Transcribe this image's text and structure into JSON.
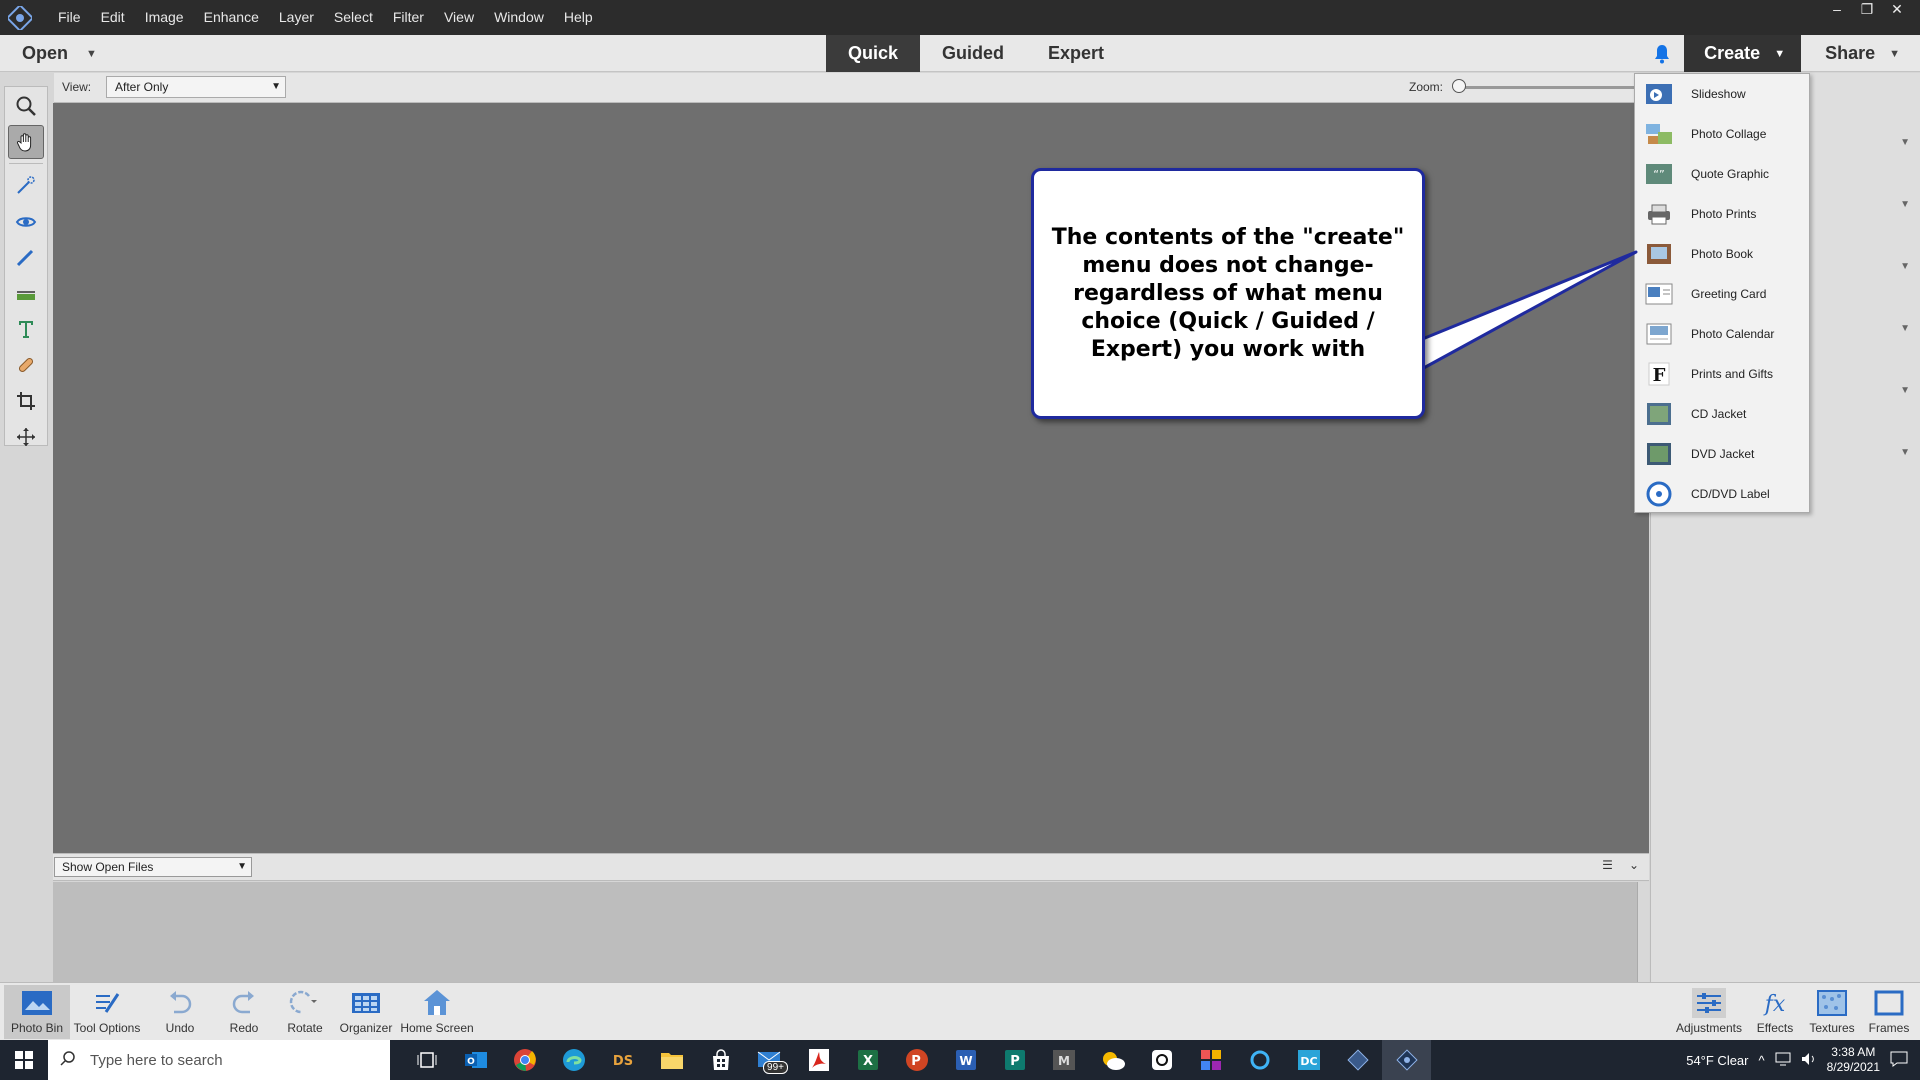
{
  "menubar": {
    "items": [
      "File",
      "Edit",
      "Image",
      "Enhance",
      "Layer",
      "Select",
      "Filter",
      "View",
      "Window",
      "Help"
    ],
    "window_controls": [
      "–",
      "❐",
      "✕"
    ]
  },
  "modebar": {
    "open_label": "Open",
    "tabs": [
      "Quick",
      "Guided",
      "Expert"
    ],
    "active_tab": "Quick",
    "create_label": "Create",
    "share_label": "Share"
  },
  "viewbar": {
    "view_label": "View:",
    "view_value": "After Only",
    "zoom_label": "Zoom:",
    "zoom_value": "1%"
  },
  "callout": {
    "text": "The contents of the \"create\" menu does not change- regardless of what menu choice (Quick / Guided / Expert) you work with"
  },
  "create_menu": {
    "items": [
      "Slideshow",
      "Photo Collage",
      "Quote Graphic",
      "Photo Prints",
      "Photo Book",
      "Greeting Card",
      "Photo Calendar",
      "Prints and Gifts",
      "CD Jacket",
      "DVD Jacket",
      "CD/DVD Label"
    ]
  },
  "photobin": {
    "select_value": "Show Open Files"
  },
  "bottombar": {
    "photo_bin": "Photo Bin",
    "tool_options": "Tool Options",
    "undo": "Undo",
    "redo": "Redo",
    "rotate": "Rotate",
    "organizer": "Organizer",
    "home_screen": "Home Screen",
    "adjustments": "Adjustments",
    "effects": "Effects",
    "textures": "Textures",
    "frames": "Frames"
  },
  "taskbar": {
    "search_placeholder": "Type here to search",
    "badge": "99+",
    "weather": "54°F  Clear",
    "time": "3:38 AM",
    "date": "8/29/2021"
  },
  "colors": {
    "accent_blue": "#1473e6",
    "callout_border": "#1f2a9e",
    "canvas": "#6f6f6f"
  }
}
